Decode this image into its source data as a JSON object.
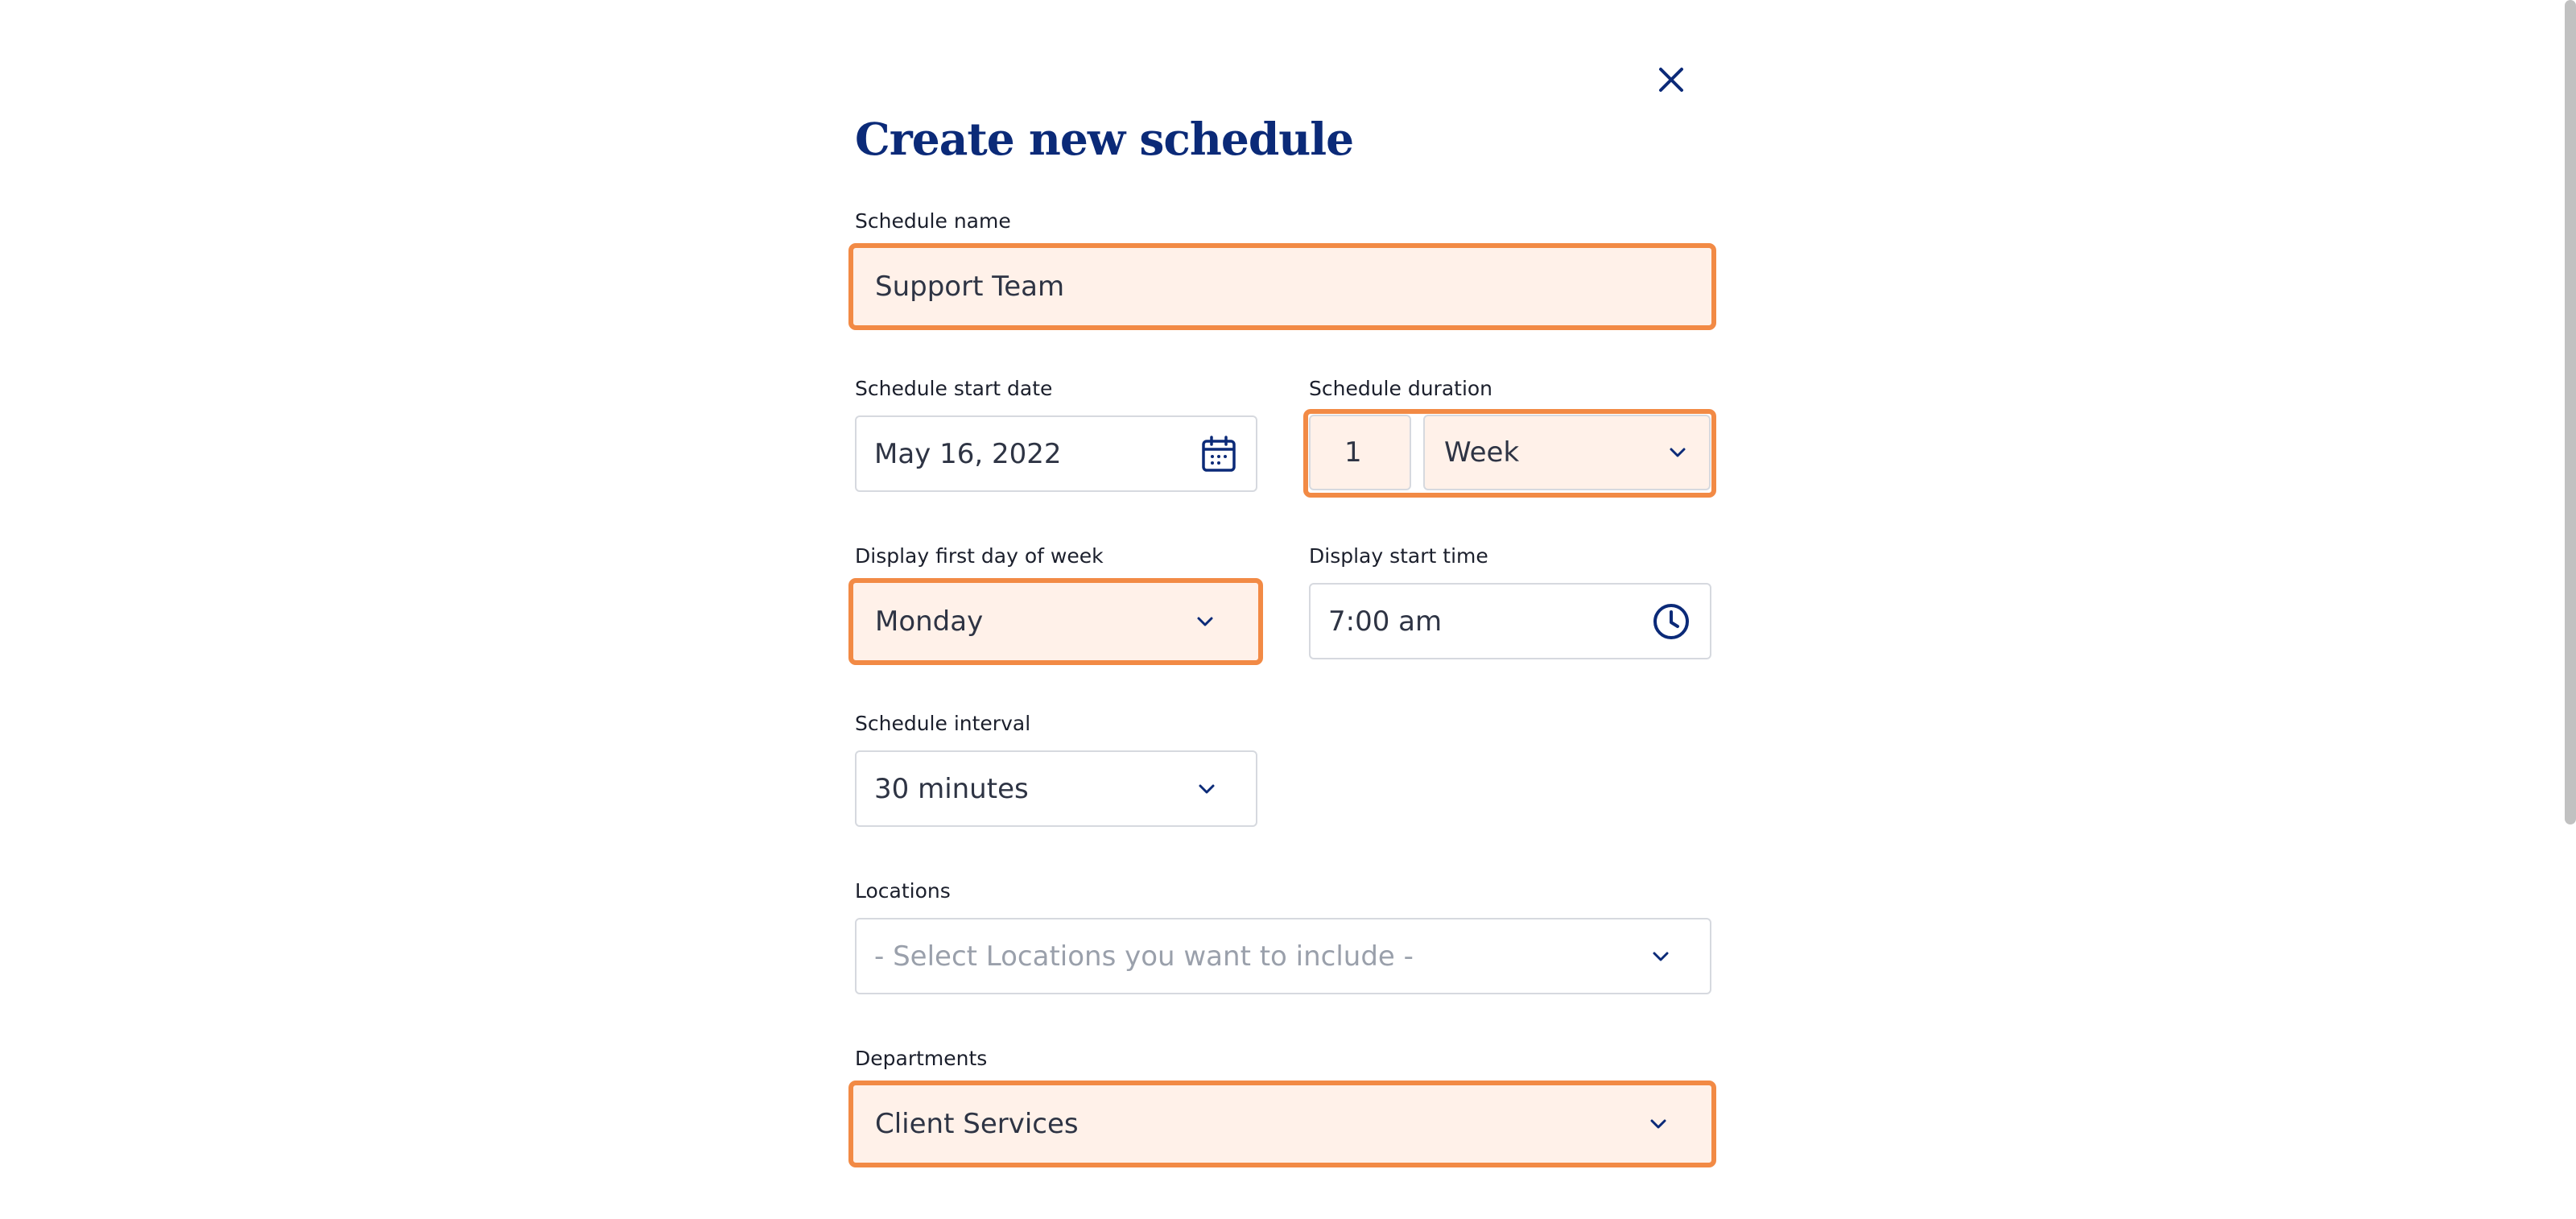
{
  "dialog": {
    "title": "Create new schedule",
    "close_icon": "close-icon"
  },
  "fields": {
    "schedule_name": {
      "label": "Schedule name",
      "value": "Support Team"
    },
    "start_date": {
      "label": "Schedule start date",
      "value": "May 16, 2022",
      "icon": "calendar-icon"
    },
    "duration": {
      "label": "Schedule duration",
      "number": "1",
      "unit": "Week"
    },
    "first_day": {
      "label": "Display first day of week",
      "value": "Monday"
    },
    "start_time": {
      "label": "Display start time",
      "value": "7:00 am",
      "icon": "clock-icon"
    },
    "interval": {
      "label": "Schedule interval",
      "value": "30 minutes"
    },
    "locations": {
      "label": "Locations",
      "placeholder": "- Select Locations you want to include -"
    },
    "departments": {
      "label": "Departments",
      "value": "Client Services"
    }
  },
  "colors": {
    "title": "#0b2a78",
    "highlight_border": "#f28a45",
    "highlight_fill": "#fff1e9",
    "icon": "#0b2a78"
  }
}
